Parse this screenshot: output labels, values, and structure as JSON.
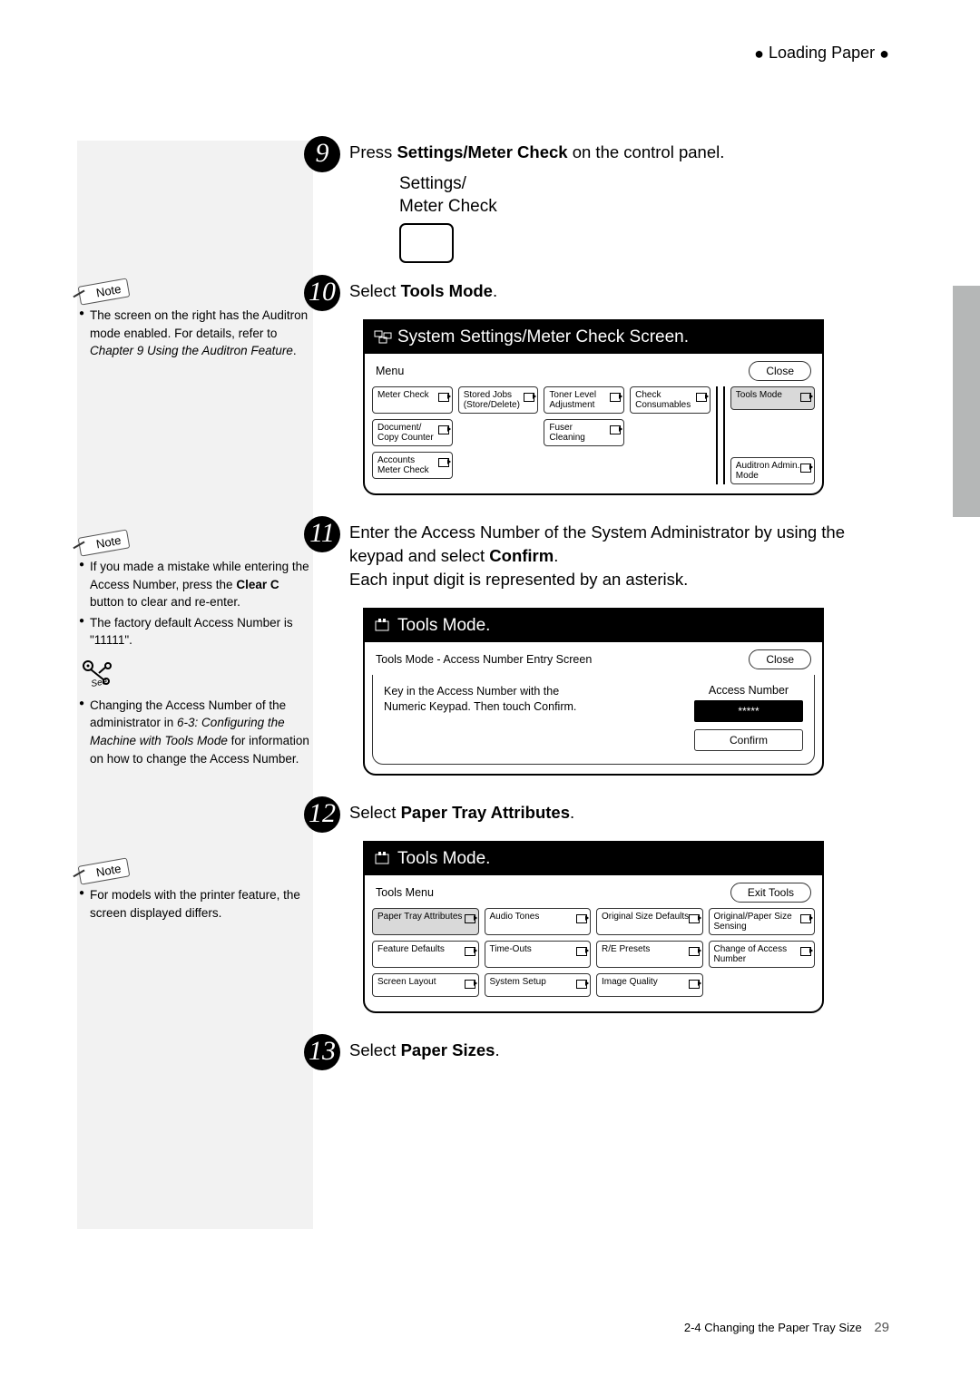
{
  "header": {
    "breadcrumb": "Loading Paper"
  },
  "sidebar": {
    "note_label": "Note",
    "see_label": "See",
    "block1": {
      "items": [
        {
          "pre": "The screen on the right has the Auditron mode enabled. For details, refer to ",
          "ital": "Chapter 9 Using the Auditron Feature",
          "post": "."
        }
      ]
    },
    "block2": {
      "items": [
        {
          "pre": "If you made a mistake while entering the Access Number, press the ",
          "bold": "Clear C",
          "post": " button to clear and re-enter."
        },
        {
          "pre": "The factory default Access Number is \"11111\"."
        }
      ]
    },
    "block3": {
      "items": [
        {
          "pre": "Changing the Access Number of the administrator in ",
          "ital": "6-3: Configuring the Machine with Tools Mode",
          "post": " for information on how to change the Access Number."
        }
      ]
    },
    "block4": {
      "items": [
        {
          "pre": "For models with the printer feature, the screen displayed differs."
        }
      ]
    }
  },
  "steps": {
    "s9": {
      "num": "9",
      "text_pre": "Press ",
      "text_bold": "Settings/Meter Check",
      "text_post": " on the control panel."
    },
    "s10": {
      "num": "10",
      "text_pre": "Select ",
      "text_bold": "Tools Mode",
      "text_post": "."
    },
    "s11": {
      "num": "11",
      "line1": "Enter the Access Number of the System Administrator by using the keypad and select ",
      "line1_bold": "Confirm",
      "line1_post": ".",
      "line2": "Each input digit is represented by an asterisk."
    },
    "s12": {
      "num": "12",
      "text_pre": "Select ",
      "text_bold": "Paper Tray Attributes",
      "text_post": "."
    },
    "s13": {
      "num": "13",
      "text_pre": "Select ",
      "text_bold": "Paper Sizes",
      "text_post": "."
    }
  },
  "kbd": {
    "line1": "Settings/",
    "line2": "Meter Check"
  },
  "panel1": {
    "title": "System Settings/Meter Check Screen",
    "menu_label": "Menu",
    "close": "Close",
    "row1": [
      "Meter Check",
      "Stored Jobs (Store/Delete)",
      "Toner Level Adjustment",
      "Check Consumables",
      "Tools Mode"
    ],
    "row2_left": "Document/ Copy Counter",
    "row2_mid": "Fuser Cleaning",
    "row3_left": "Accounts Meter Check",
    "row3_right": "Auditron Admin. Mode"
  },
  "panel2": {
    "title": "Tools Mode",
    "subtitle": "Tools Mode - Access Number Entry Screen",
    "close": "Close",
    "instr1": "Key in the Access Number with the",
    "instr2": "Numeric Keypad. Then touch Confirm.",
    "field_label": "Access Number",
    "field_value": "*****",
    "confirm": "Confirm"
  },
  "panel3": {
    "title": "Tools Mode",
    "subtitle": "Tools Menu",
    "exit": "Exit Tools",
    "grid": [
      [
        "Paper Tray Attributes",
        "Audio Tones",
        "Original Size Defaults",
        "Original/Paper Size Sensing"
      ],
      [
        "Feature Defaults",
        "Time-Outs",
        "R/E Presets",
        "Change of Access Number"
      ],
      [
        "Screen Layout",
        "System Setup",
        "Image Quality",
        ""
      ]
    ]
  },
  "footer": {
    "section": "2-4 Changing the Paper Tray Size",
    "page": "29"
  }
}
